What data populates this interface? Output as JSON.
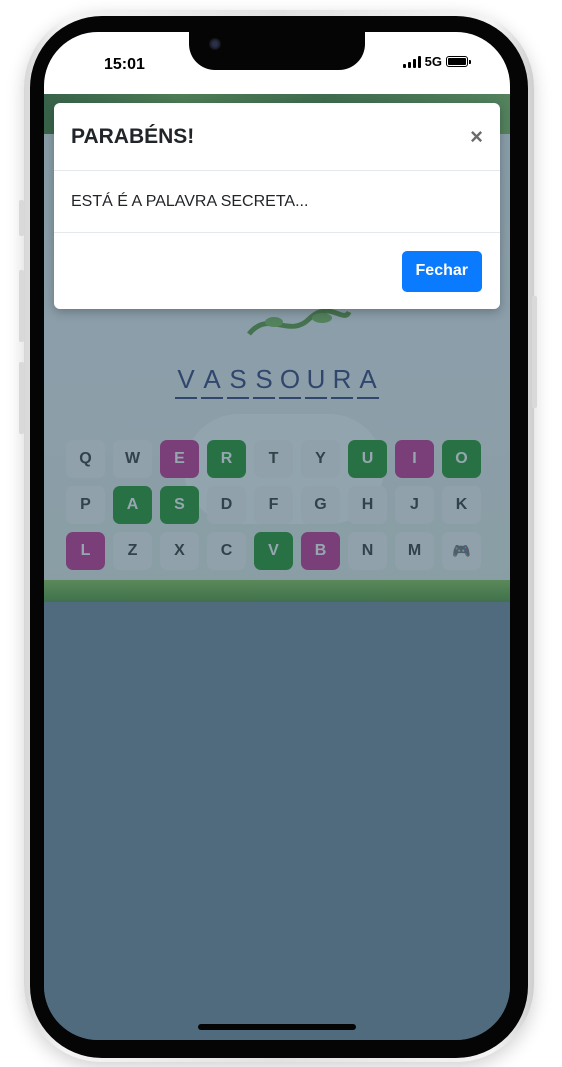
{
  "status_bar": {
    "time": "15:01",
    "network": "5G"
  },
  "game": {
    "secret_word": [
      "V",
      "A",
      "S",
      "S",
      "O",
      "U",
      "R",
      "A"
    ],
    "keyboard": {
      "rows": [
        [
          {
            "label": "Q",
            "state": "unused"
          },
          {
            "label": "W",
            "state": "unused"
          },
          {
            "label": "E",
            "state": "miss"
          },
          {
            "label": "R",
            "state": "hit"
          },
          {
            "label": "T",
            "state": "unused"
          },
          {
            "label": "Y",
            "state": "unused"
          },
          {
            "label": "U",
            "state": "hit"
          },
          {
            "label": "I",
            "state": "miss"
          },
          {
            "label": "O",
            "state": "hit"
          }
        ],
        [
          {
            "label": "P",
            "state": "unused"
          },
          {
            "label": "A",
            "state": "hit"
          },
          {
            "label": "S",
            "state": "hit"
          },
          {
            "label": "D",
            "state": "unused"
          },
          {
            "label": "F",
            "state": "unused"
          },
          {
            "label": "G",
            "state": "unused"
          },
          {
            "label": "H",
            "state": "unused"
          },
          {
            "label": "J",
            "state": "unused"
          },
          {
            "label": "K",
            "state": "unused"
          }
        ],
        [
          {
            "label": "L",
            "state": "miss"
          },
          {
            "label": "Z",
            "state": "unused"
          },
          {
            "label": "X",
            "state": "unused"
          },
          {
            "label": "C",
            "state": "unused"
          },
          {
            "label": "V",
            "state": "hit"
          },
          {
            "label": "B",
            "state": "miss"
          },
          {
            "label": "N",
            "state": "unused"
          },
          {
            "label": "M",
            "state": "unused"
          },
          {
            "label": "🎮",
            "state": "icon",
            "icon": "gamepad-icon"
          }
        ]
      ]
    }
  },
  "modal": {
    "title": "PARABÉNS!",
    "close_symbol": "×",
    "message": "ESTÁ É A PALAVRA SECRETA...",
    "button_label": "Fechar"
  },
  "colors": {
    "hit": "#0b8a14",
    "miss": "#c21c88",
    "button": "#0a7bff",
    "overlay": "#4f6b7d"
  }
}
